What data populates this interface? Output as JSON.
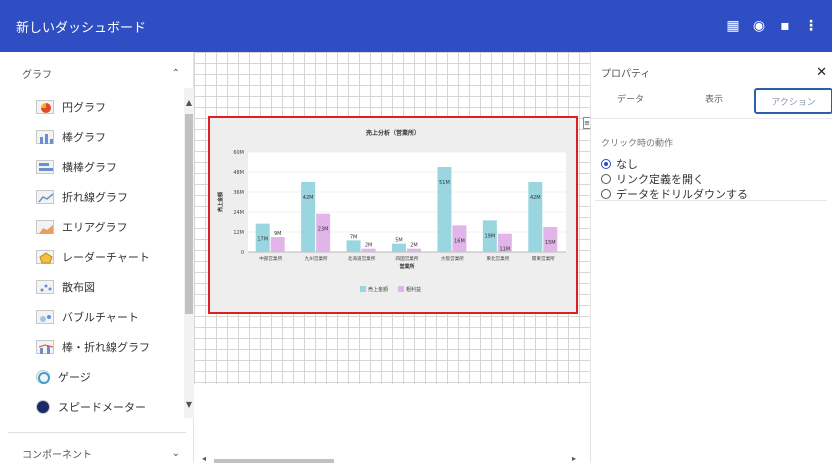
{
  "app": {
    "title": "新しいダッシュボード",
    "toolbar": [
      {
        "icon": "grid-icon",
        "glyph": "▦"
      },
      {
        "icon": "eye-icon",
        "glyph": "◉"
      },
      {
        "icon": "save-icon",
        "glyph": "▪"
      },
      {
        "icon": "more-vertical-icon",
        "glyph": "⋮"
      }
    ]
  },
  "sidebar": {
    "section": "グラフ",
    "items": [
      {
        "label": "円グラフ",
        "icon": "pie-chart-icon"
      },
      {
        "label": "棒グラフ",
        "icon": "bar-chart-icon"
      },
      {
        "label": "横棒グラフ",
        "icon": "horizontal-bar-chart-icon"
      },
      {
        "label": "折れ線グラフ",
        "icon": "line-chart-icon"
      },
      {
        "label": "エリアグラフ",
        "icon": "area-chart-icon"
      },
      {
        "label": "レーダーチャート",
        "icon": "radar-chart-icon"
      },
      {
        "label": "散布図",
        "icon": "scatter-chart-icon"
      },
      {
        "label": "バブルチャート",
        "icon": "bubble-chart-icon"
      },
      {
        "label": "棒・折れ線グラフ",
        "icon": "combo-chart-icon"
      },
      {
        "label": "ゲージ",
        "icon": "gauge-icon"
      },
      {
        "label": "スピードメーター",
        "icon": "speedometer-icon"
      }
    ],
    "footer": "コンポーネント"
  },
  "properties": {
    "title": "プロパティ",
    "tabs": [
      "データ",
      "表示",
      "アクション"
    ],
    "active_tab": "アクション",
    "click_action_label": "クリック時の動作",
    "options": [
      "なし",
      "リンク定義を開く",
      "データをドリルダウンする"
    ],
    "selected_option": "なし"
  },
  "chart_data": {
    "type": "bar",
    "title": "売上分析（営業所）",
    "xlabel": "営業所",
    "ylabel": "売上金額",
    "ylim": [
      0,
      60
    ],
    "ytick_labels": [
      "0",
      "12M",
      "24M",
      "36M",
      "48M",
      "60M"
    ],
    "categories": [
      "中部営業所",
      "九州営業所",
      "北海道営業所",
      "四国営業所",
      "大阪営業所",
      "東北営業所",
      "関東営業所"
    ],
    "series": [
      {
        "name": "売上金額",
        "color": "#9ad6e0",
        "values": [
          17,
          42,
          7,
          5,
          51,
          19,
          42
        ],
        "labels": [
          "17M",
          "42M",
          "7M",
          "5M",
          "51M",
          "19M",
          "42M"
        ]
      },
      {
        "name": "粗利益",
        "color": "#e2b5ea",
        "values": [
          9,
          23,
          2,
          2,
          16,
          11,
          15
        ],
        "labels": [
          "9M",
          "23M",
          "2M",
          "2M",
          "16M",
          "11M",
          "15M"
        ]
      }
    ],
    "legend": "bottom",
    "grid": true
  }
}
